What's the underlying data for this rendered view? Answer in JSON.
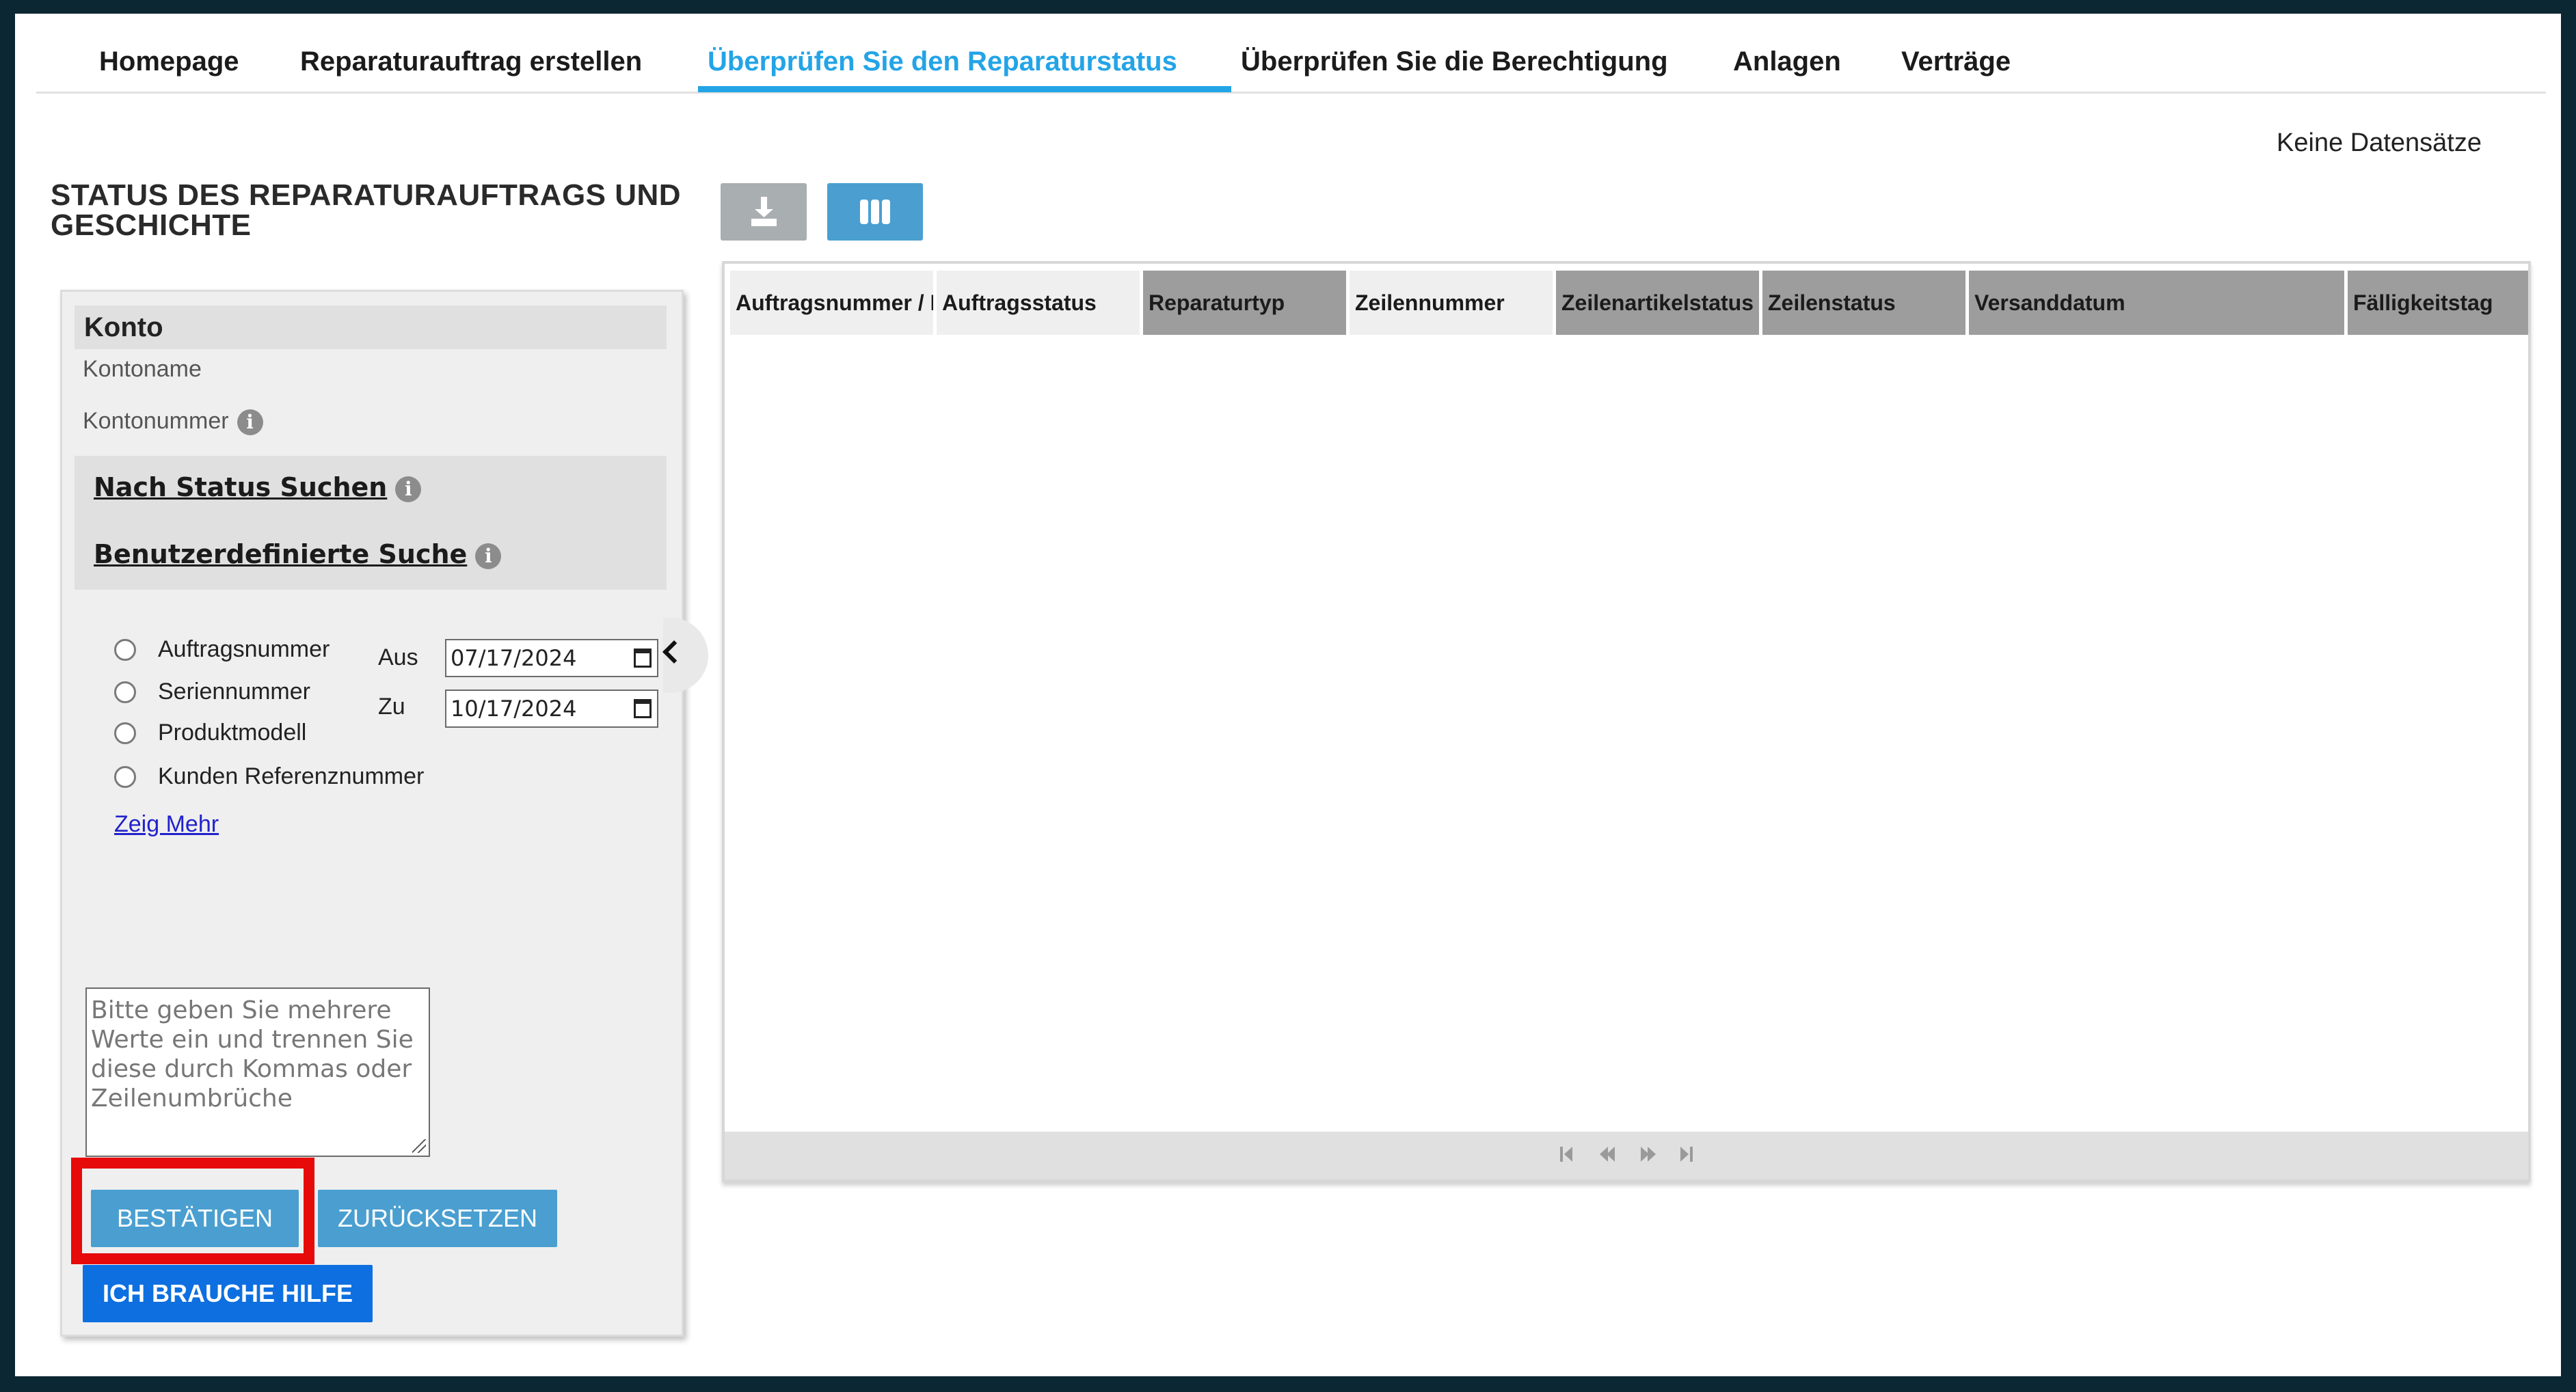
{
  "nav": {
    "tabs": [
      {
        "label": "Homepage"
      },
      {
        "label": "Reparaturauftrag erstellen"
      },
      {
        "label": "Überprüfen Sie den Reparaturstatus",
        "active": true
      },
      {
        "label": "Überprüfen Sie die Berechtigung"
      },
      {
        "label": "Anlagen"
      },
      {
        "label": "Verträge"
      }
    ]
  },
  "page": {
    "title": "STATUS DES REPARATURAUFTRAGS UND GESCHICHTE",
    "records_status": "Keine Datensätze"
  },
  "toolbar": {
    "download_icon": "download-icon",
    "columns_icon": "columns-icon"
  },
  "panel": {
    "section_title": "Konto",
    "account_name_label": "Kontoname",
    "account_number_label": "Kontonummer",
    "search_by_status": "Nach Status Suchen",
    "custom_search": "Benutzerdefinierte Suche",
    "info_symbol": "i",
    "radio_options": [
      {
        "label": "Auftragsnummer"
      },
      {
        "label": "Seriennummer"
      },
      {
        "label": "Produktmodell"
      },
      {
        "label": "Kunden Referenznummer"
      }
    ],
    "from_label": "Aus",
    "to_label": "Zu",
    "from_date": "07/17/2024",
    "to_date": "10/17/2024",
    "show_more": "Zeig Mehr",
    "values_placeholder": "Bitte geben Sie mehrere Werte ein und trennen Sie diese durch Kommas oder Zeilenumbrüche",
    "confirm_button": "BESTÄTIGEN",
    "reset_button": "ZURÜCKSETZEN",
    "help_button": "ICH BRAUCHE HILFE"
  },
  "grid": {
    "columns": [
      {
        "label": "Auftragsnummer / I"
      },
      {
        "label": "Auftragsstatus"
      },
      {
        "label": "Reparaturtyp"
      },
      {
        "label": "Zeilennummer"
      },
      {
        "label": "Zeilenartikelstatus"
      },
      {
        "label": "Zeilenstatus"
      },
      {
        "label": "Versanddatum"
      },
      {
        "label": "Fälligkeitstag"
      }
    ],
    "rows": []
  },
  "colors": {
    "accent": "#23a4e6",
    "button": "#4a9fd0",
    "help_button": "#0d6fe0",
    "highlight": "#e60a0a"
  }
}
